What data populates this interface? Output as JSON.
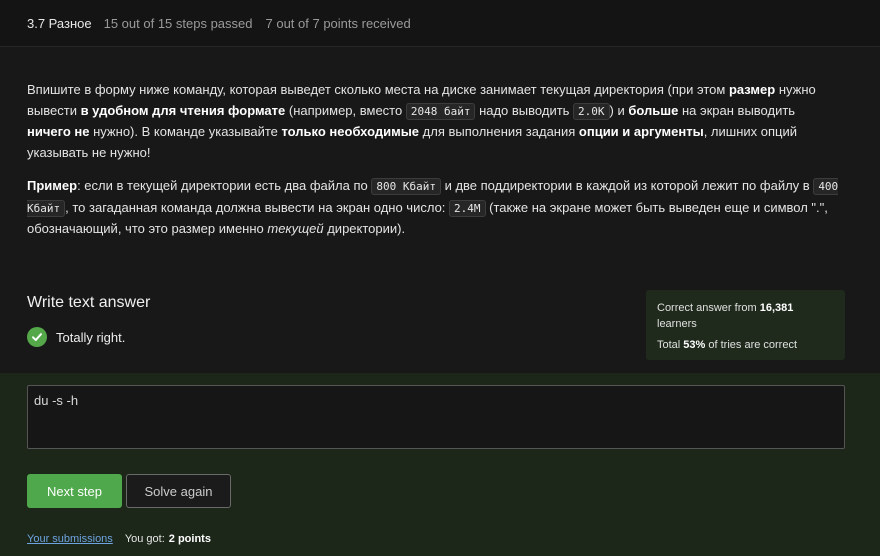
{
  "header": {
    "step_title": "3.7 Разное",
    "steps_passed": "15 out of 15 steps passed",
    "points": "7 out of 7 points  received"
  },
  "task": {
    "p1": {
      "t1": "Впишите в форму ниже команду, которая выведет сколько места на диске занимает текущая директория (при этом ",
      "b1": "размер",
      "t2": " нужно вывести ",
      "b2": "в удобном для чтения формате",
      "t3": " (например, вместо ",
      "c1": "2048 байт",
      "t4": " надо выводить ",
      "c2": "2.0K",
      "t5": ") и ",
      "b3": "больше",
      "t6": " на экран выводить ",
      "b4": "ничего не",
      "t7": " нужно). В команде указывайте ",
      "b5": "только необходимые",
      "t8": " для выполнения задания ",
      "b6": "опции и аргументы",
      "t9": ", лишних опций указывать не нужно!"
    },
    "p2": {
      "b1": "Пример",
      "t1": ": если в текущей директории есть два файла по ",
      "c1": "800 Кбайт",
      "t2": " и две поддиректории в каждой из которой лежит по файлу в ",
      "c2": "400 Кбайт",
      "t3": ", то загаданная команда должна вывести на экран одно число: ",
      "c3": "2.4M",
      "t4": " (также на экране может быть выведен еще и символ \".\", обозначающий, что это размер именно ",
      "i1": "текущей",
      "t5": " директории)."
    }
  },
  "answer": {
    "title": "Write text answer",
    "status_text": "Totally right.",
    "value": "du -s -h"
  },
  "stats": {
    "line1_prefix": "Correct answer from ",
    "learners_count": "16,381",
    "line1_suffix": " learners",
    "line2_prefix": "Total ",
    "percent": "53%",
    "line2_suffix": " of tries are correct"
  },
  "buttons": {
    "next": "Next step",
    "solve": "Solve again"
  },
  "footer": {
    "submissions_link": "Your submissions",
    "got_label": "You got:",
    "got_value": "2 points"
  },
  "colors": {
    "accent_green": "#4fa84b",
    "check_green": "#54a84a",
    "link_blue": "#6da4e0"
  },
  "icons": {
    "status": "check-circle-icon"
  }
}
